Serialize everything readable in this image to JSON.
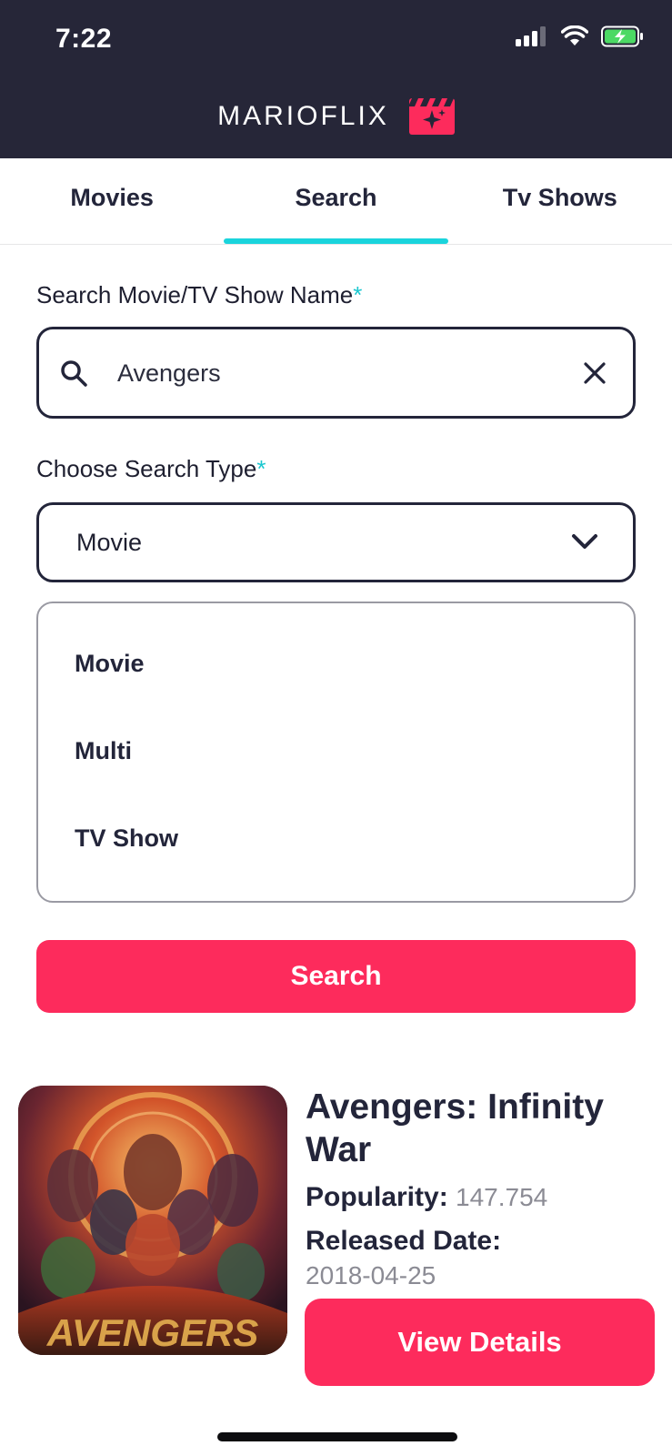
{
  "status_bar": {
    "time": "7:22",
    "icons": [
      "signal-icon",
      "wifi-icon",
      "battery-charging-icon"
    ]
  },
  "header": {
    "app_name": "MARIOFLIX",
    "logo_icon": "clapperboard-sparkle-icon"
  },
  "tabs": [
    {
      "label": "Movies",
      "active": false
    },
    {
      "label": "Search",
      "active": true
    },
    {
      "label": "Tv Shows",
      "active": false
    }
  ],
  "form": {
    "name_label": "Search Movie/TV Show Name",
    "required_mark": "*",
    "search_value": "Avengers",
    "type_label": "Choose Search Type",
    "type_selected": "Movie",
    "type_options": [
      "Movie",
      "Multi",
      "TV Show"
    ],
    "submit_label": "Search"
  },
  "result": {
    "title": "Avengers: Infinity War",
    "popularity_label": "Popularity:",
    "popularity_value": "147.754",
    "released_label": "Released Date:",
    "released_value": "2018-04-25",
    "details_button": "View Details",
    "poster_text": "AVENGERS"
  },
  "colors": {
    "header_bg": "#262638",
    "accent_tab": "#1ad4dc",
    "primary_button": "#fd2b5c",
    "text_dark": "#23253a"
  }
}
